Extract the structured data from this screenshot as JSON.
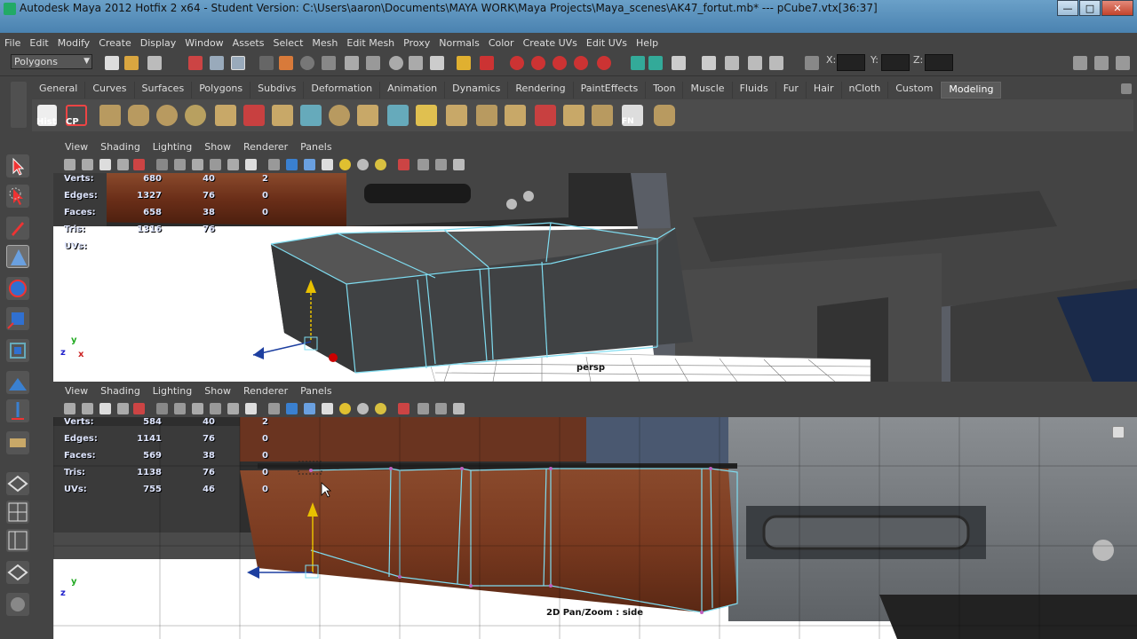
{
  "window": {
    "title": "Autodesk Maya 2012 Hotfix 2 x64 - Student Version: C:\\Users\\aaron\\Documents\\MAYA WORK\\Maya Projects\\Maya_scenes\\AK47_fortut.mb*  ---  pCube7.vtx[36:37]",
    "minimize": "—",
    "maximize": "□",
    "close": "✕"
  },
  "menu": [
    "File",
    "Edit",
    "Modify",
    "Create",
    "Display",
    "Window",
    "Assets",
    "Select",
    "Mesh",
    "Edit Mesh",
    "Proxy",
    "Normals",
    "Color",
    "Create UVs",
    "Edit UVs",
    "Help"
  ],
  "status_line": {
    "mode": "Polygons",
    "x_label": "X:",
    "y_label": "Y:",
    "z_label": "Z:"
  },
  "shelf": {
    "tabs": [
      "General",
      "Curves",
      "Surfaces",
      "Polygons",
      "Subdivs",
      "Deformation",
      "Animation",
      "Dynamics",
      "Rendering",
      "PaintEffects",
      "Toon",
      "Muscle",
      "Fluids",
      "Fur",
      "Hair",
      "nCloth",
      "Custom",
      "Modeling"
    ],
    "active_tab": "Modeling",
    "hist_label": "Hist",
    "cp_label": "CP",
    "fn_label": "FN"
  },
  "viewport_menu": [
    "View",
    "Shading",
    "Lighting",
    "Show",
    "Renderer",
    "Panels"
  ],
  "viewport_top": {
    "camera": "persp",
    "hud": [
      {
        "label": "Verts:",
        "a": "680",
        "b": "40",
        "c": "2"
      },
      {
        "label": "Edges:",
        "a": "1327",
        "b": "76",
        "c": "0"
      },
      {
        "label": "Faces:",
        "a": "658",
        "b": "38",
        "c": "0"
      },
      {
        "label": "Tris:",
        "a": "1316",
        "b": "76",
        "c": ""
      },
      {
        "label": "UVs:",
        "a": "",
        "b": "",
        "c": ""
      }
    ],
    "axis_y": "y",
    "axis_z": "z",
    "axis_x": "x"
  },
  "viewport_bottom": {
    "camera": "2D Pan/Zoom : side",
    "hud": [
      {
        "label": "Verts:",
        "a": "584",
        "b": "40",
        "c": "2"
      },
      {
        "label": "Edges:",
        "a": "1141",
        "b": "76",
        "c": "0"
      },
      {
        "label": "Faces:",
        "a": "569",
        "b": "38",
        "c": "0"
      },
      {
        "label": "Tris:",
        "a": "1138",
        "b": "76",
        "c": "0"
      },
      {
        "label": "UVs:",
        "a": "755",
        "b": "46",
        "c": "0"
      }
    ],
    "axis_y": "y",
    "axis_z": "z"
  },
  "colors": {
    "wood": "#7a3a22",
    "metal": "#3a3a3a",
    "wire": "#7fdcf0",
    "background": "#444444"
  }
}
